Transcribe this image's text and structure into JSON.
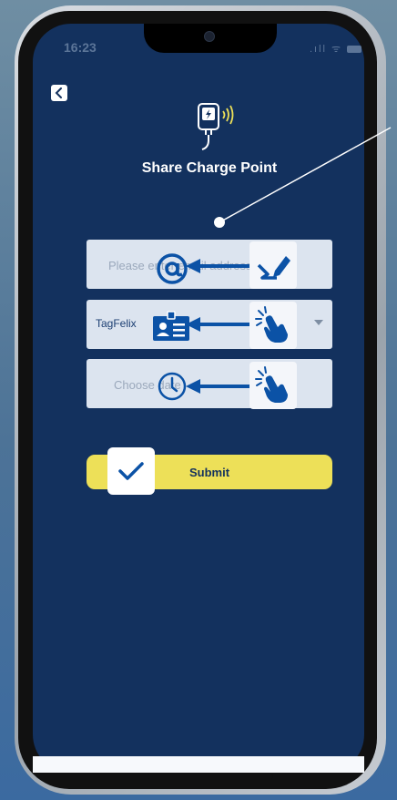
{
  "status_bar": {
    "time": "16:23",
    "signal": ".ıll ᯤ"
  },
  "screen": {
    "title": "Share Charge Point"
  },
  "form": {
    "email_placeholder": "Please enter email address",
    "tag_value": "TagFelix",
    "date_placeholder": "Choose date",
    "submit_label": "Submit"
  },
  "icons": {
    "back": "chevron-left-icon",
    "charger": "charger-icon",
    "email": "at-sign-icon",
    "tag": "id-card-icon",
    "date": "clock-icon",
    "type_gesture": "pen-scribble-icon",
    "tap_gesture": "hand-tap-icon",
    "submit_gesture": "checkmark-icon"
  },
  "colors": {
    "screen_bg": "#13315e",
    "field_bg": "#dce4ef",
    "accent": "#ede058",
    "annotation_blue": "#0b52a6"
  }
}
